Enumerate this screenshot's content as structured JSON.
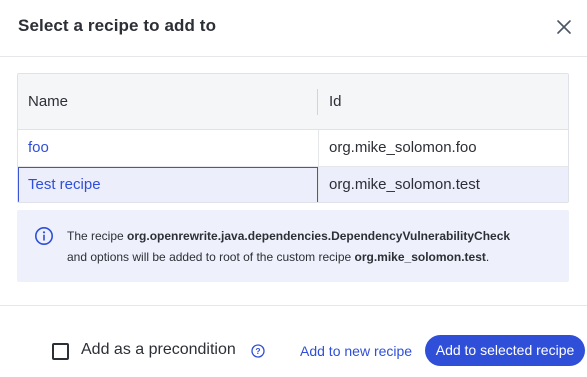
{
  "dialog": {
    "title": "Select a recipe to add to",
    "close_icon": "close-icon"
  },
  "table": {
    "columns": [
      "Name",
      "Id"
    ],
    "rows": [
      {
        "name": "foo",
        "id": "org.mike_solomon.foo",
        "selected": false
      },
      {
        "name": "Test recipe",
        "id": "org.mike_solomon.test",
        "selected": true
      }
    ]
  },
  "info": {
    "icon": "info-icon",
    "prefix": "The recipe ",
    "recipe": "org.openrewrite.java.dependencies.DependencyVulnerabilityCheck",
    "middle": "and options will be added to root of the custom recipe ",
    "target": "org.mike_solomon.test",
    "suffix": "."
  },
  "footer": {
    "precondition_label": "Add as a precondition",
    "precondition_checked": false,
    "help_icon": "help-circle-icon",
    "add_new_label": "Add to new recipe",
    "add_selected_label": "Add to selected recipe"
  },
  "colors": {
    "accent": "#2f4fd8",
    "selected_row": "#eceefb",
    "info_bg": "#eef0fb"
  }
}
